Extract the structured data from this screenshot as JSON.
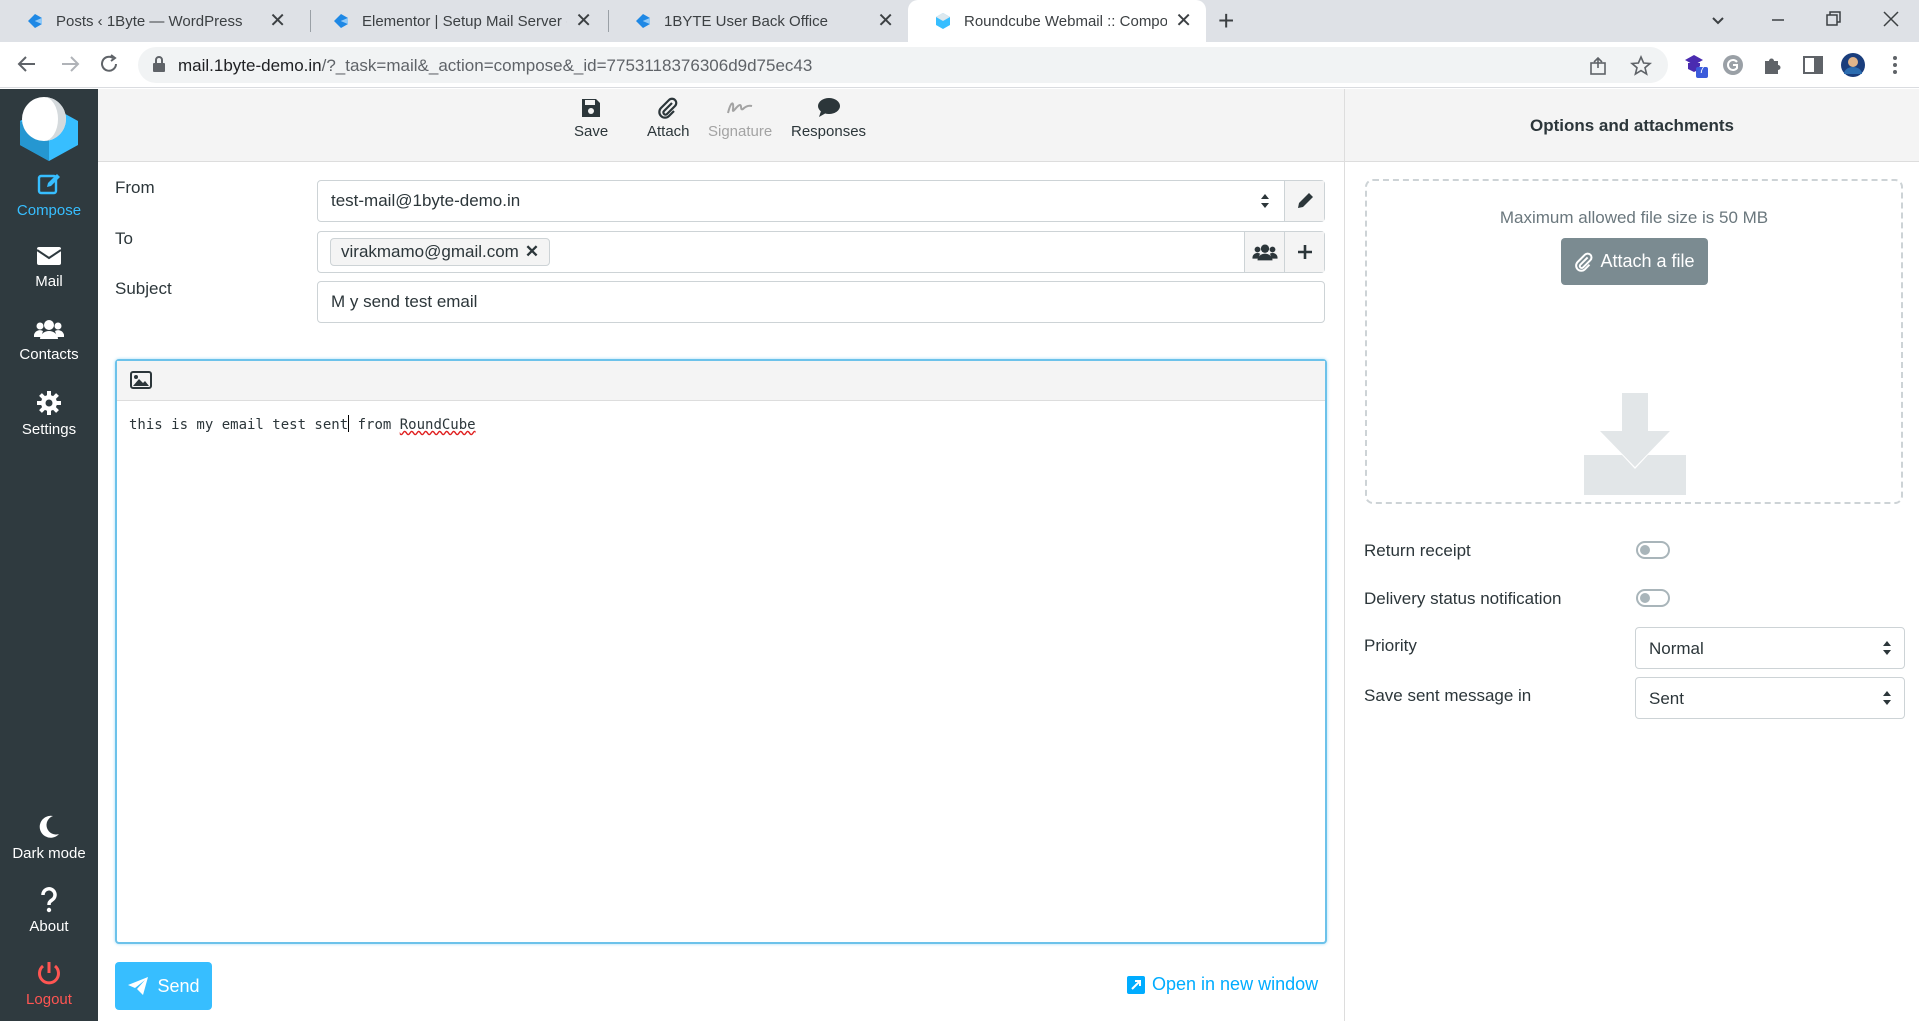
{
  "browser": {
    "tabs": [
      {
        "title": "Posts ‹ 1Byte — WordPress",
        "close": "✕"
      },
      {
        "title": "Elementor | Setup Mail Server (Ro",
        "close": "✕"
      },
      {
        "title": "1BYTE User Back Office",
        "close": "✕"
      },
      {
        "title": "Roundcube Webmail :: Compose",
        "close": "✕"
      }
    ],
    "new_tab": "+",
    "url_domain": "mail.1byte-demo.in",
    "url_path": "/?_task=mail&_action=compose&_id=7753118376306d9d75ec43",
    "extension_badge": "7"
  },
  "sidebar": {
    "items": [
      {
        "label": "Compose"
      },
      {
        "label": "Mail"
      },
      {
        "label": "Contacts"
      },
      {
        "label": "Settings"
      }
    ],
    "bottom": [
      {
        "label": "Dark mode"
      },
      {
        "label": "About"
      },
      {
        "label": "Logout"
      }
    ]
  },
  "toolbar": {
    "save": "Save",
    "attach": "Attach",
    "signature": "Signature",
    "responses": "Responses"
  },
  "compose": {
    "from_label": "From",
    "from_value": "test-mail@1byte-demo.in",
    "to_label": "To",
    "to_recipient": "virakmamo@gmail.com",
    "recipient_remove": "✕",
    "subject_label": "Subject",
    "subject_value": "M y send test email",
    "body_before_caret": "this is my email test sent",
    "body_after_caret": " from ",
    "body_spell": "RoundCube",
    "send_label": "Send",
    "open_new_window": "Open in new window"
  },
  "options": {
    "title": "Options and attachments",
    "max_size": "Maximum allowed file size is 50 MB",
    "attach_file": "Attach a file",
    "return_receipt_label": "Return receipt",
    "return_receipt_on": false,
    "dsn_label": "Delivery status notification",
    "dsn_on": false,
    "priority_label": "Priority",
    "priority_value": "Normal",
    "save_in_label": "Save sent message in",
    "save_in_value": "Sent"
  },
  "colors": {
    "sidebar_bg": "#2f3a3f",
    "accent": "#37beff",
    "logout": "#ff5552",
    "link": "#00acff",
    "attach_btn": "#7b8b91"
  }
}
